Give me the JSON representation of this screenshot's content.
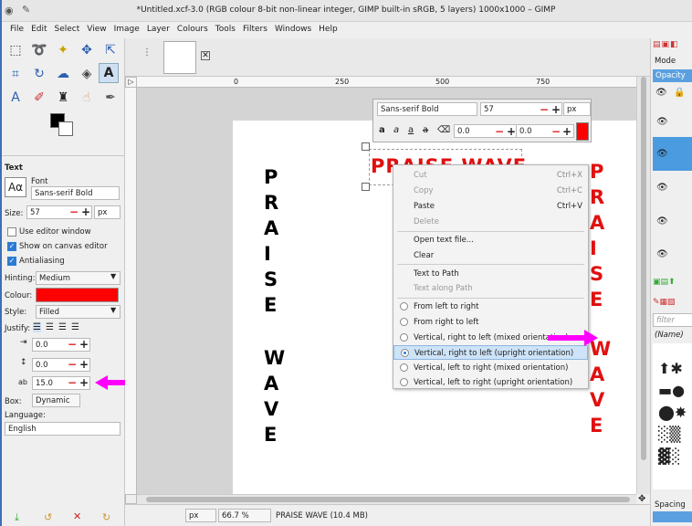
{
  "window": {
    "title": "*Untitled.xcf-3.0 (RGB colour 8-bit non-linear integer, GIMP built-in sRGB, 5 layers) 1000x1000 – GIMP"
  },
  "menu": [
    "File",
    "Edit",
    "Select",
    "View",
    "Image",
    "Layer",
    "Colours",
    "Tools",
    "Filters",
    "Windows",
    "Help"
  ],
  "tool_options": {
    "section_title": "Text",
    "font_label": "Font",
    "font_value": "Sans-serif Bold",
    "size_label": "Size:",
    "size_value": "57",
    "size_unit": "px",
    "use_editor": "Use editor window",
    "show_canvas_editor": "Show on canvas editor",
    "antialiasing": "Antialiasing",
    "hinting_label": "Hinting:",
    "hinting_value": "Medium",
    "colour_label": "Colour:",
    "style_label": "Style:",
    "style_value": "Filled",
    "justify_label": "Justify:",
    "indent_value": "0.0",
    "line_spacing_value": "0.0",
    "letter_spacing_value": "15.0",
    "box_label": "Box:",
    "box_value": "Dynamic",
    "language_label": "Language:",
    "language_value": "English"
  },
  "ruler": {
    "marks": [
      "0",
      "250",
      "500",
      "750"
    ]
  },
  "canvas": {
    "black_text": [
      "P",
      "R",
      "A",
      "I",
      "S",
      "E",
      "W",
      "A",
      "V",
      "E"
    ],
    "red_text": [
      "P",
      "R",
      "A",
      "I",
      "S",
      "E",
      "W",
      "A",
      "V",
      "E"
    ],
    "horizontal_text": "PRAISE WAVE"
  },
  "text_toolbar": {
    "font": "Sans-serif Bold",
    "size": "57",
    "unit": "px",
    "baseline": "0.0",
    "kerning": "0.0",
    "colour": "#ff0000"
  },
  "context_menu": {
    "cut": "Cut",
    "cut_sc": "Ctrl+X",
    "copy": "Copy",
    "copy_sc": "Ctrl+C",
    "paste": "Paste",
    "paste_sc": "Ctrl+V",
    "delete": "Delete",
    "open_text": "Open text file...",
    "clear": "Clear",
    "text_to_path": "Text to Path",
    "text_along_path": "Text along Path",
    "dir_ltr": "From left to right",
    "dir_rtl": "From right to left",
    "dir_vrl_mixed": "Vertical, right to left (mixed orientation)",
    "dir_vrl_upright": "Vertical, right to left (upright orientation)",
    "dir_vlr_mixed": "Vertical, left to right (mixed orientation)",
    "dir_vlr_upright": "Vertical, left to right (upright orientation)"
  },
  "right_dock": {
    "mode_label": "Mode",
    "opacity_label": "Opacity",
    "filter_placeholder": "filter",
    "brush_name": "(Name)",
    "spacing_label": "Spacing"
  },
  "status": {
    "unit": "px",
    "zoom": "66.7 %",
    "info": "PRAISE WAVE (10.4 MB)"
  },
  "colors": {
    "accent": "#2b7bd6",
    "text_red": "#e01010",
    "arrow": "#ff00ff"
  }
}
